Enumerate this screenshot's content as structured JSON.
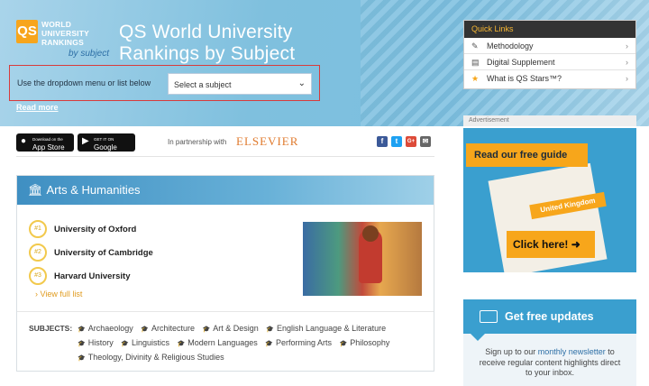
{
  "header": {
    "logo_qs": "QS",
    "logo_lines": [
      "WORLD",
      "UNIVERSITY",
      "RANKINGS"
    ],
    "logo_by_subject": "by subject",
    "title_line1": "QS World University",
    "title_line2": "Rankings by Subject",
    "dropdown_label": "Use the dropdown menu or list below",
    "select_value": "Select a subject",
    "read_more": "Read more"
  },
  "apps": {
    "appstore_small": "Download on the",
    "appstore": "App Store",
    "googleplay_small": "GET IT ON",
    "googleplay": "Google Play"
  },
  "partner": {
    "text": "In partnership with",
    "brand": "ELSEVIER"
  },
  "social": [
    "f",
    "t",
    "G+",
    "✉"
  ],
  "panel": {
    "title": "Arts & Humanities",
    "universities": [
      {
        "rank": "#1",
        "name": "University of Oxford"
      },
      {
        "rank": "#2",
        "name": "University of Cambridge"
      },
      {
        "rank": "#3",
        "name": "Harvard University"
      }
    ],
    "view_full_list": "View full list",
    "subjects_label": "SUBJECTS:",
    "subjects": [
      "Archaeology",
      "Architecture",
      "Art & Design",
      "English Language & Literature",
      "History",
      "Linguistics",
      "Modern Languages",
      "Performing Arts",
      "Philosophy",
      "Theology, Divinity & Religious Studies"
    ]
  },
  "quick_links": {
    "title": "Quick Links",
    "items": [
      {
        "label": "Methodology",
        "icon": "ruler-icon"
      },
      {
        "label": "Digital Supplement",
        "icon": "book-icon"
      },
      {
        "label": "What is QS Stars™?",
        "icon": "star-icon"
      }
    ]
  },
  "ad": {
    "label": "Advertisement",
    "headline": "Read our free guide",
    "book_label": "United Kingdom",
    "cta": "Click here!"
  },
  "updates": {
    "title": "Get free updates",
    "text_before": "Sign up to our ",
    "text_link": "monthly newsletter",
    "text_after": " to receive regular content highlights direct to your inbox."
  },
  "colors": {
    "accent": "#f7a61b",
    "blue": "#3a9fcf",
    "highlight": "#d83b3b"
  }
}
